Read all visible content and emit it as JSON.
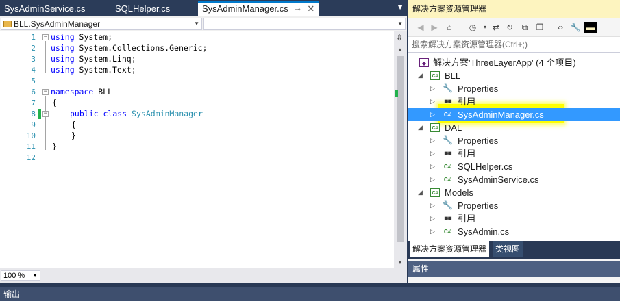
{
  "tabs": [
    {
      "label": "SysAdminService.cs"
    },
    {
      "label": "SQLHelper.cs"
    },
    {
      "label": "SysAdminManager.cs",
      "pin": "⊸",
      "close": "✕"
    }
  ],
  "tab_menu": "▼",
  "navbar": {
    "left_combo": "BLL.SysAdminManager",
    "right_combo": ""
  },
  "code_lines": [
    {
      "n": "1",
      "text": ""
    },
    {
      "n": "2",
      "text": ""
    },
    {
      "n": "3",
      "text": ""
    },
    {
      "n": "4",
      "text": ""
    },
    {
      "n": "5",
      "text": ""
    },
    {
      "n": "6",
      "text": ""
    },
    {
      "n": "7",
      "text": "{"
    },
    {
      "n": "8",
      "text": ""
    },
    {
      "n": "9",
      "text": "{"
    },
    {
      "n": "10",
      "text": "}"
    },
    {
      "n": "11",
      "text": "}"
    },
    {
      "n": "12",
      "text": ""
    }
  ],
  "code": {
    "kw_using": "using",
    "ns1": " System;",
    "ns2": " System.Collections.Generic;",
    "ns3": " System.Linq;",
    "ns4": " System.Text;",
    "kw_namespace": "namespace",
    "ns_name": " BLL",
    "kw_public": "public",
    "kw_class": "class",
    "class_name": "SysAdminManager"
  },
  "zoom": "100 %",
  "solution_explorer": {
    "title": "解决方案资源管理器",
    "search_placeholder": "搜索解决方案资源管理器(Ctrl+;)",
    "tree": [
      {
        "label": "解决方案'ThreeLayerApp' (4 个项目)",
        "icon": "solution-icon"
      },
      {
        "label": "BLL",
        "icon": "csharp-project-icon"
      },
      {
        "label": "Properties",
        "icon": "wrench-icon"
      },
      {
        "label": "引用",
        "icon": "references-icon"
      },
      {
        "label": "SysAdminManager.cs",
        "icon": "csharp-file-icon"
      },
      {
        "label": "DAL",
        "icon": "csharp-project-icon"
      },
      {
        "label": "Properties",
        "icon": "wrench-icon"
      },
      {
        "label": "引用",
        "icon": "references-icon"
      },
      {
        "label": "SQLHelper.cs",
        "icon": "csharp-file-icon"
      },
      {
        "label": "SysAdminService.cs",
        "icon": "csharp-file-icon"
      },
      {
        "label": "Models",
        "icon": "csharp-project-icon"
      },
      {
        "label": "Properties",
        "icon": "wrench-icon"
      },
      {
        "label": "引用",
        "icon": "references-icon"
      },
      {
        "label": "SysAdmin.cs",
        "icon": "csharp-file-icon"
      }
    ],
    "bottom_tabs": [
      "解决方案资源管理器",
      "类视图"
    ]
  },
  "properties": {
    "title": "属性"
  },
  "output": {
    "title": "输出"
  },
  "colors": {
    "accent": "#007acc",
    "selection": "#3399ff",
    "highlight": "#ffff00",
    "chrome": "#293955"
  }
}
